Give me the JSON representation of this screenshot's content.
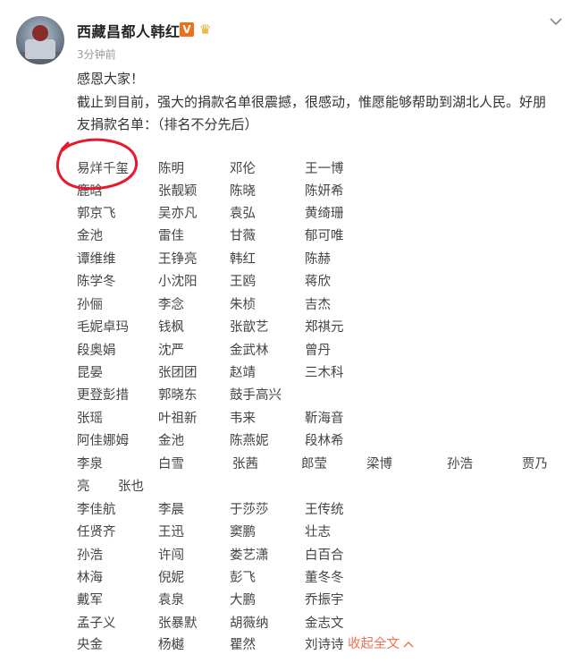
{
  "post": {
    "username": "西藏昌都人韩红",
    "verified_badge": "V",
    "crown_icon": "crown-icon",
    "time": "3分钟前",
    "greeting": "感恩大家！",
    "intro_line1": "截止到目前，强大的捐款名单很震撼，很感动，惟愿能够帮助到湖北人民。好朋",
    "intro_line2": "友捐款名单：（排名不分先后）"
  },
  "names": [
    [
      "易烊千玺",
      "陈明",
      "邓伦",
      "王一博"
    ],
    [
      "鹿晗",
      "张靓颖",
      "陈晓",
      "陈妍希"
    ],
    [
      "郭京飞",
      "吴亦凡",
      "袁弘",
      "黄绮珊"
    ],
    [
      "金池",
      "雷佳",
      "甘薇",
      "郁可唯"
    ],
    [
      "谭维维",
      "王铮亮",
      "韩红",
      "陈赫"
    ],
    [
      "陈学冬",
      "小沈阳",
      "王鸥",
      "蒋欣"
    ],
    [
      "孙俪",
      "李念",
      "朱桢",
      "吉杰"
    ],
    [
      "毛妮卓玛",
      "钱枫",
      "张歆艺",
      "郑祺元"
    ],
    [
      "段奥娟",
      "沈严",
      "金武林",
      "曾丹"
    ],
    [
      "昆晏",
      "张团团",
      "赵靖",
      "三木科"
    ],
    [
      "更登彭措",
      "郭晓东",
      "鼓手高兴"
    ],
    [
      "张瑶",
      "叶祖新",
      "韦来",
      "靳海音"
    ],
    [
      "阿佳娜姆",
      "金池",
      "陈燕妮",
      "段林希"
    ],
    [
      "李泉",
      "白雪",
      "张茜",
      "郎莹",
      "梁博",
      "孙浩",
      "贾乃"
    ],
    [
      "亮",
      "张也"
    ],
    [
      "李佳航",
      "李晨",
      "于莎莎",
      "王传统"
    ],
    [
      "任贤齐",
      "王迅",
      "窦鹏",
      "壮志"
    ],
    [
      "孙浩",
      "许闯",
      "娄艺潇",
      "白百合"
    ],
    [
      "林海",
      "倪妮",
      "彭飞",
      "董冬冬"
    ],
    [
      "戴军",
      "袁泉",
      "大鹏",
      "乔振宇"
    ],
    [
      "孟子义",
      "张暴默",
      "胡薇纳",
      "金志文"
    ],
    [
      "央金",
      "杨樾",
      "瞿然",
      "刘诗诗"
    ]
  ],
  "collapse_label": "收起全文",
  "colors": {
    "accent_link": "#eb7350",
    "highlight_circle": "#e8192c",
    "vip_badge": "#f0701a"
  }
}
